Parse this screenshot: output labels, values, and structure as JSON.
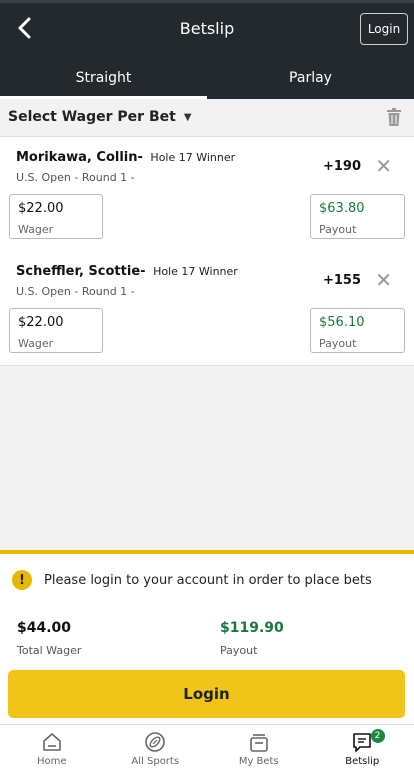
{
  "header": {
    "title": "Betslip",
    "login_label": "Login"
  },
  "tabs": [
    {
      "label": "Straight",
      "active": true
    },
    {
      "label": "Parlay",
      "active": false
    }
  ],
  "wager_select": {
    "label": "Select Wager Per Bet"
  },
  "bets": [
    {
      "player": "Morikawa, Collin-",
      "market": "Hole 17 Winner",
      "event": "U.S. Open - Round 1 -",
      "odds": "+190",
      "wager": "$22.00",
      "wager_label": "Wager",
      "payout": "$63.80",
      "payout_label": "Payout"
    },
    {
      "player": "Scheffler, Scottie-",
      "market": "Hole 17 Winner",
      "event": "U.S. Open - Round 1 -",
      "odds": "+155",
      "wager": "$22.00",
      "wager_label": "Wager",
      "payout": "$56.10",
      "payout_label": "Payout"
    }
  ],
  "summary": {
    "notice": "Please login to your account in order to place bets",
    "total_wager": "$44.00",
    "total_wager_label": "Total Wager",
    "payout": "$119.90",
    "payout_label": "Payout",
    "login_button": "Login"
  },
  "nav": [
    {
      "label": "Home",
      "icon": "home-icon"
    },
    {
      "label": "All Sports",
      "icon": "football-icon"
    },
    {
      "label": "My Bets",
      "icon": "bets-icon"
    },
    {
      "label": "Betslip",
      "icon": "betslip-icon",
      "badge": "2",
      "active": true
    }
  ],
  "colors": {
    "header_bg": "#24292e",
    "accent": "#f0c419",
    "payout_green": "#1a7a3c"
  }
}
